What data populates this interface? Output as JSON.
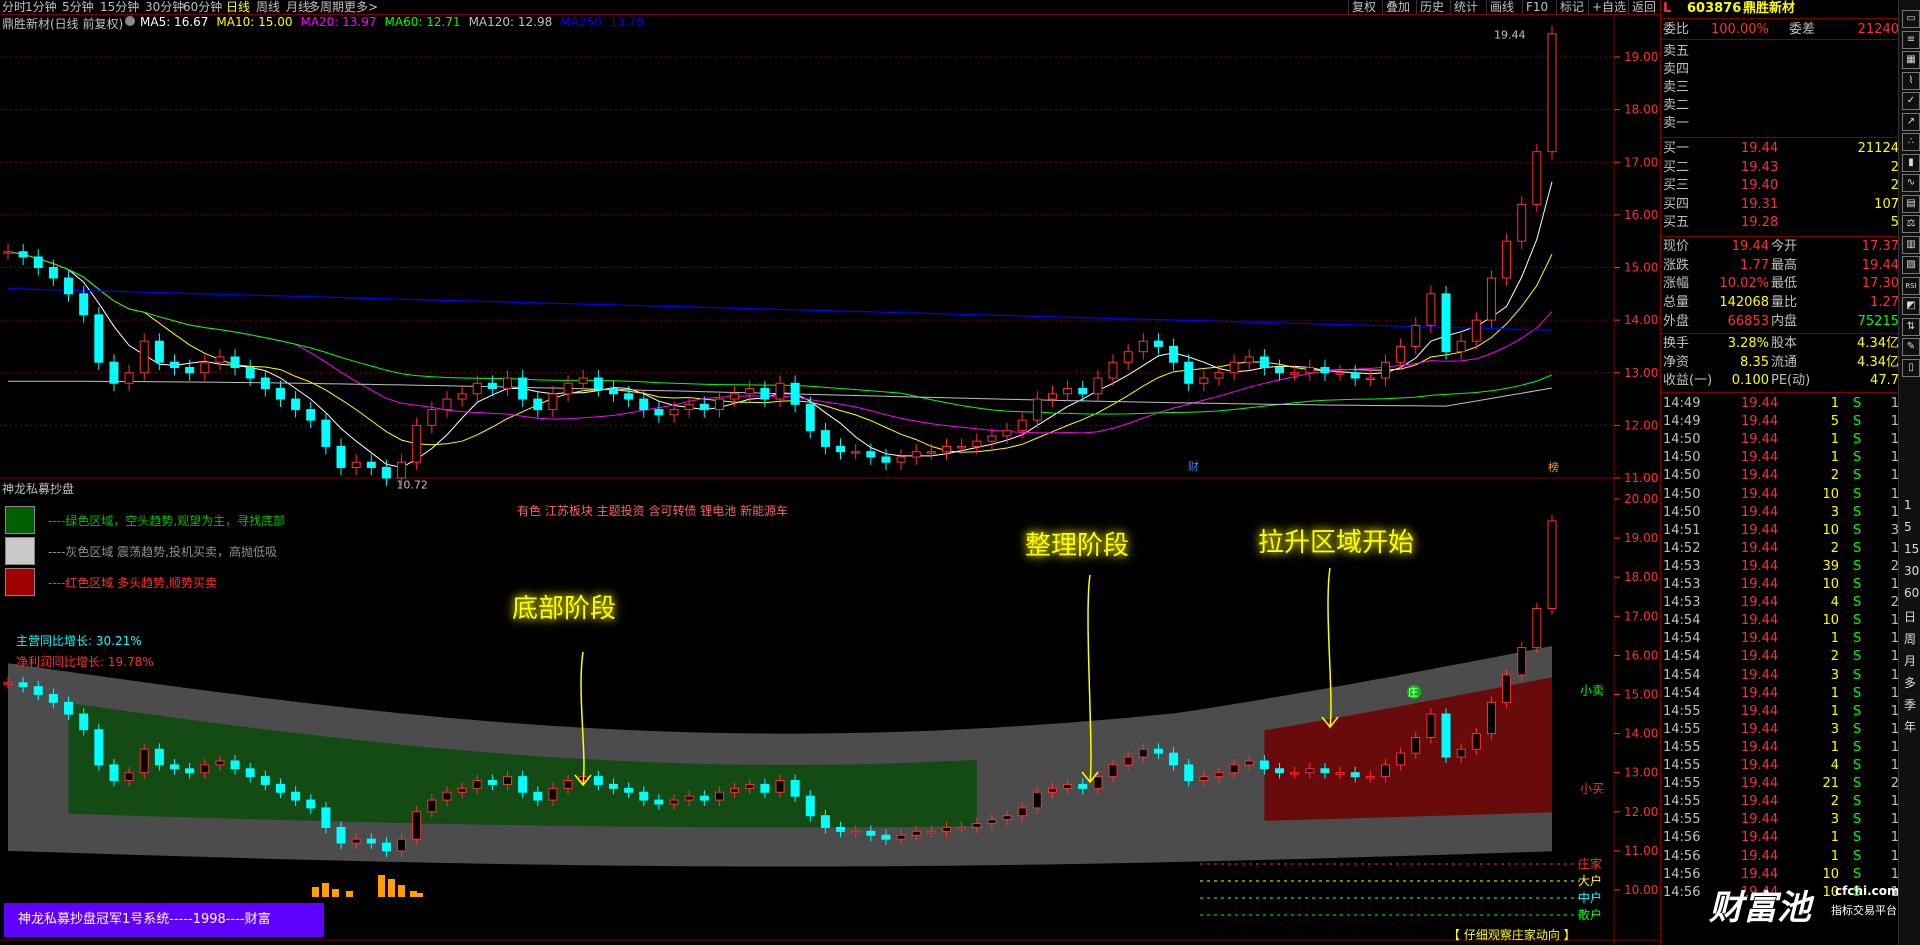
{
  "toolbar": {
    "left_items": [
      "分时",
      "1分钟",
      "5分钟",
      "15分钟",
      "30分钟",
      "60分钟",
      "日线",
      "周线",
      "月线",
      "多周期",
      "更多>"
    ],
    "active": "日线",
    "right_items": [
      "复权",
      "叠加",
      "历史",
      "统计",
      "画线",
      "F10",
      "标记",
      "+自选",
      "返回"
    ]
  },
  "main_chart": {
    "title": "鼎胜新材(日线 前复权)",
    "ma_labels": [
      {
        "text": "MA5: 16.67",
        "color": "#ffffff"
      },
      {
        "text": "MA10: 15.00",
        "color": "#ffff00"
      },
      {
        "text": "MA20: 13.97",
        "color": "#ff00ff"
      },
      {
        "text": "MA60: 12.71",
        "color": "#00ff00"
      },
      {
        "text": "MA120: 12.98",
        "color": "#c0c0c0"
      },
      {
        "text": "MA250: 13.78",
        "color": "#0000ff"
      }
    ],
    "y_ticks": [
      "19.00",
      "18.00",
      "17.00",
      "16.00",
      "15.00",
      "14.00",
      "13.00",
      "12.00",
      "11.00"
    ],
    "high_label": "19.44",
    "low_label": "10.72",
    "marker_cai": "财",
    "marker_bang": "榜"
  },
  "indicator": {
    "title": "神龙私募抄盘",
    "legend": [
      {
        "text": "----绿色区域，空头趋势,观望为主，寻找底部",
        "box": "#006000",
        "color": "#00c000"
      },
      {
        "text": "----灰色区域 震荡趋势,投机买卖，高抛低吸",
        "box": "#c8c8c8",
        "color": "#909090"
      },
      {
        "text": "----红色区域 多头趋势,顺势买卖",
        "box": "#a00000",
        "color": "#ff3030"
      }
    ],
    "sector_text": "有色 江苏板块 主题投资 含可转债 锂电池 新能源车",
    "stat1": "主营同比增长: 30.21%",
    "stat2": "净利润同比增长: 19.78%",
    "annotations": [
      "底部阶段",
      "整理阶段",
      "拉升区域开始"
    ],
    "y_ticks": [
      "20.00",
      "19.00",
      "18.00",
      "17.00",
      "16.00",
      "15.00",
      "14.00",
      "13.00",
      "12.00",
      "11.00",
      "10.00"
    ],
    "band_labels": [
      "小卖",
      "小买"
    ],
    "level_labels": [
      "庄家",
      "大户",
      "中户",
      "散户"
    ],
    "footer_banner": "神龙私募抄盘冠军1号系统-----1998----财富",
    "footer_tip": "【 仔细观察庄家动向 】",
    "zhuang_badge": "庄"
  },
  "quote": {
    "code": "603876",
    "name": "鼎胜新材",
    "weibi_label": "委比",
    "weibi_value": "100.00%",
    "weicha_label": "委差",
    "weicha_value": "21240",
    "sell": [
      "卖五",
      "卖四",
      "卖三",
      "卖二",
      "卖一"
    ],
    "buy": [
      {
        "label": "买一",
        "price": "19.44",
        "vol": "21124"
      },
      {
        "label": "买二",
        "price": "19.43",
        "vol": "2"
      },
      {
        "label": "买三",
        "price": "19.40",
        "vol": "2"
      },
      {
        "label": "买四",
        "price": "19.31",
        "vol": "107"
      },
      {
        "label": "买五",
        "price": "19.28",
        "vol": "5"
      }
    ],
    "stats": [
      {
        "l1": "现价",
        "v1": "19.44",
        "l2": "今开",
        "v2": "17.37",
        "c1": "#ff3030",
        "c2": "#ff3030"
      },
      {
        "l1": "涨跌",
        "v1": "1.77",
        "l2": "最高",
        "v2": "19.44",
        "c1": "#ff3030",
        "c2": "#ff3030"
      },
      {
        "l1": "涨幅",
        "v1": "10.02%",
        "l2": "最低",
        "v2": "17.30",
        "c1": "#ff3030",
        "c2": "#ff3030"
      },
      {
        "l1": "总量",
        "v1": "142068",
        "l2": "量比",
        "v2": "1.27",
        "c1": "#ffff00",
        "c2": "#ff3030"
      },
      {
        "l1": "外盘",
        "v1": "66853",
        "l2": "内盘",
        "v2": "75215",
        "c1": "#ff3030",
        "c2": "#00ff00"
      },
      {
        "l1": "换手",
        "v1": "3.28%",
        "l2": "股本",
        "v2": "4.34亿",
        "c1": "#ffff00",
        "c2": "#ffff00"
      },
      {
        "l1": "净资",
        "v1": "8.35",
        "l2": "流通",
        "v2": "4.34亿",
        "c1": "#ffff00",
        "c2": "#ffff00"
      },
      {
        "l1": "收益(一)",
        "v1": "0.100",
        "l2": "PE(动)",
        "v2": "47.7",
        "c1": "#ffff00",
        "c2": "#ffff00"
      }
    ],
    "ticks": [
      [
        "14:49",
        "19.44",
        "1",
        "S",
        "1"
      ],
      [
        "14:49",
        "19.44",
        "5",
        "S",
        "1"
      ],
      [
        "14:50",
        "19.44",
        "1",
        "S",
        "1"
      ],
      [
        "14:50",
        "19.44",
        "1",
        "S",
        "1"
      ],
      [
        "14:50",
        "19.44",
        "2",
        "S",
        "1"
      ],
      [
        "14:50",
        "19.44",
        "10",
        "S",
        "1"
      ],
      [
        "14:50",
        "19.44",
        "3",
        "S",
        "1"
      ],
      [
        "14:51",
        "19.44",
        "10",
        "S",
        "3"
      ],
      [
        "14:52",
        "19.44",
        "2",
        "S",
        "1"
      ],
      [
        "14:53",
        "19.44",
        "39",
        "S",
        "2"
      ],
      [
        "14:53",
        "19.44",
        "10",
        "S",
        "1"
      ],
      [
        "14:53",
        "19.44",
        "4",
        "S",
        "2"
      ],
      [
        "14:54",
        "19.44",
        "10",
        "S",
        "1"
      ],
      [
        "14:54",
        "19.44",
        "1",
        "S",
        "1"
      ],
      [
        "14:54",
        "19.44",
        "2",
        "S",
        "1"
      ],
      [
        "14:54",
        "19.44",
        "3",
        "S",
        "1"
      ],
      [
        "14:54",
        "19.44",
        "1",
        "S",
        "1"
      ],
      [
        "14:55",
        "19.44",
        "1",
        "S",
        "1"
      ],
      [
        "14:55",
        "19.44",
        "3",
        "S",
        "1"
      ],
      [
        "14:55",
        "19.44",
        "1",
        "S",
        "1"
      ],
      [
        "14:55",
        "19.44",
        "4",
        "S",
        "1"
      ],
      [
        "14:55",
        "19.44",
        "21",
        "S",
        "2"
      ],
      [
        "14:55",
        "19.44",
        "2",
        "S",
        "1"
      ],
      [
        "14:55",
        "19.44",
        "3",
        "S",
        "1"
      ],
      [
        "14:56",
        "19.44",
        "1",
        "S",
        "1"
      ],
      [
        "14:56",
        "19.44",
        "1",
        "S",
        "1"
      ],
      [
        "14:56",
        "19.44",
        "10",
        "S",
        "1"
      ],
      [
        "14:56",
        "19.44",
        "10",
        "S",
        "1"
      ]
    ]
  },
  "side_icons": [
    "window-icon",
    "list-icon",
    "grid-icon",
    "chart-icon",
    "check-icon",
    "trend-icon",
    "scatter-icon",
    "bars-icon",
    "line-icon",
    "book-icon",
    "scale-icon",
    "bar-icon",
    "bar2-icon",
    "rsi-icon",
    "macd-icon",
    "sort-icon",
    "pen-icon",
    "page-icon"
  ],
  "side_texts": [
    "1",
    "5",
    "15",
    "30",
    "60",
    "日",
    "周",
    "月",
    "多",
    "季",
    "年"
  ],
  "watermark": {
    "logo": "财富池",
    "domain": "cfchi.com",
    "sub": "指标交易平台"
  },
  "colors": {
    "up": "#ff3030",
    "down": "#00ffff",
    "grid": "#800000",
    "axis": "#ff3030"
  }
}
